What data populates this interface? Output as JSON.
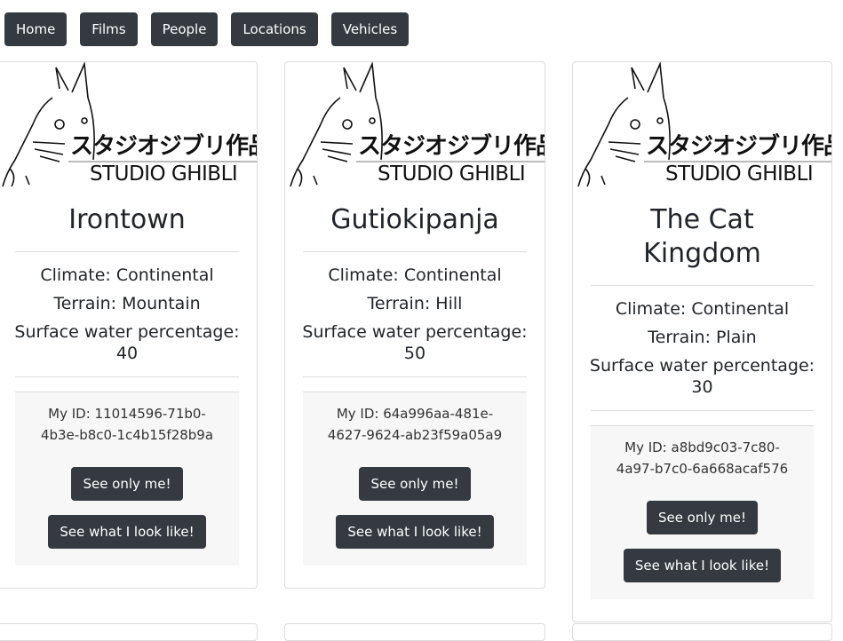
{
  "nav": {
    "items": [
      {
        "label": "Home"
      },
      {
        "label": "Films"
      },
      {
        "label": "People"
      },
      {
        "label": "Locations"
      },
      {
        "label": "Vehicles"
      }
    ]
  },
  "logo": {
    "japanese": "スタジオジブリ作品",
    "english": "STUDIO GHIBLI"
  },
  "cards": [
    {
      "title": "Irontown",
      "climate": "Climate: Continental",
      "terrain": "Terrain: Mountain",
      "surface_water": "Surface water percentage: 40",
      "id_text": "My ID: 11014596-71b0-4b3e-b8c0-1c4b15f28b9a",
      "see_only_label": "See only me!",
      "see_look_label": "See what I look like!"
    },
    {
      "title": "Gutiokipanja",
      "climate": "Climate: Continental",
      "terrain": "Terrain: Hill",
      "surface_water": "Surface water percentage: 50",
      "id_text": "My ID: 64a996aa-481e-4627-9624-ab23f59a05a9",
      "see_only_label": "See only me!",
      "see_look_label": "See what I look like!"
    },
    {
      "title": "The Cat Kingdom",
      "climate": "Climate: Continental",
      "terrain": "Terrain: Plain",
      "surface_water": "Surface water percentage: 30",
      "id_text": "My ID: a8bd9c03-7c80-4a97-b7c0-6a668acaf576",
      "see_only_label": "See only me!",
      "see_look_label": "See what I look like!"
    }
  ]
}
